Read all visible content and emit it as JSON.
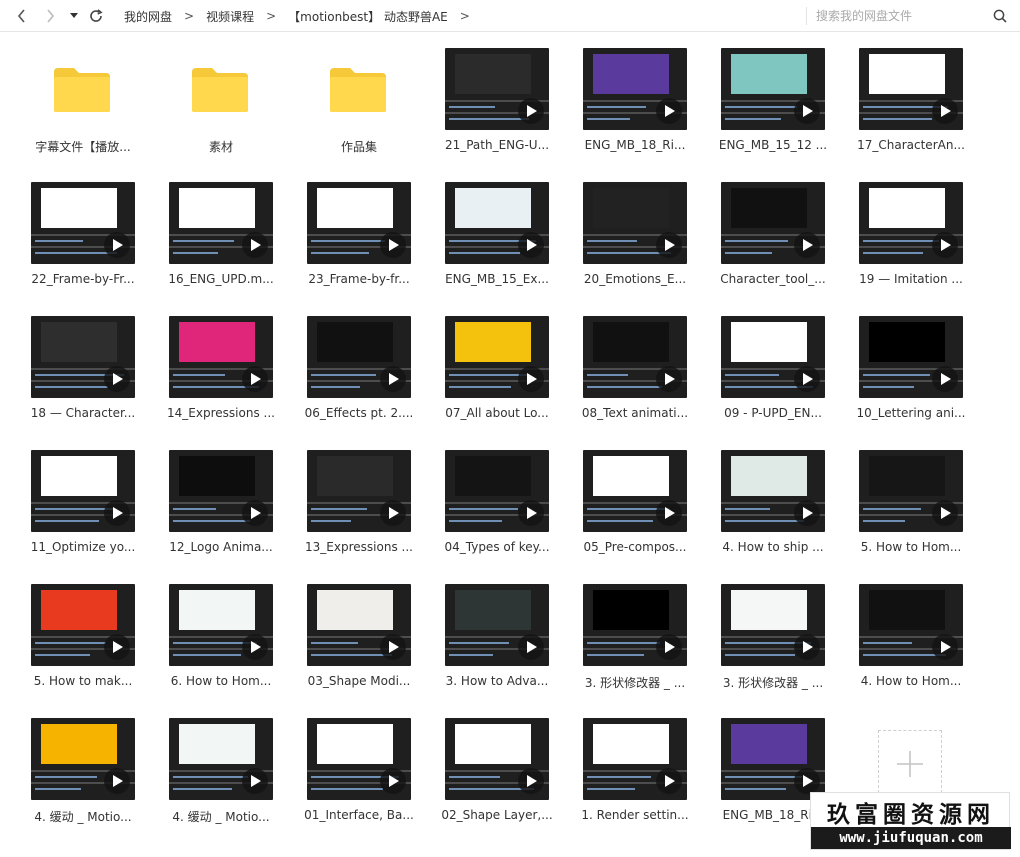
{
  "toolbar": {
    "breadcrumb": [
      "我的网盘",
      "视频课程",
      "【motionbest】 动态野兽AE"
    ],
    "search_placeholder": "搜索我的网盘文件"
  },
  "items": [
    {
      "type": "folder",
      "label": "字幕文件【播放..."
    },
    {
      "type": "folder",
      "label": "素材"
    },
    {
      "type": "folder",
      "label": "作品集"
    },
    {
      "type": "video",
      "label": "21_Path_ENG-U...",
      "panel": "#2b2b2b"
    },
    {
      "type": "video",
      "label": "ENG_MB_18_Ri...",
      "panel": "#5b3a9e"
    },
    {
      "type": "video",
      "label": "ENG_MB_15_12 ...",
      "panel": "#7fc6c0"
    },
    {
      "type": "video",
      "label": "17_CharacterAn...",
      "panel": "#ffffff"
    },
    {
      "type": "video",
      "label": "22_Frame-by-Fr...",
      "panel": "#ffffff"
    },
    {
      "type": "video",
      "label": "16_ENG_UPD.m...",
      "panel": "#ffffff"
    },
    {
      "type": "video",
      "label": "23_Frame-by-fr...",
      "panel": "#ffffff"
    },
    {
      "type": "video",
      "label": "ENG_MB_15_Ex...",
      "panel": "#e8f0f4"
    },
    {
      "type": "video",
      "label": "20_Emotions_E...",
      "panel": "#222222"
    },
    {
      "type": "video",
      "label": "Character_tool_...",
      "panel": "#111111"
    },
    {
      "type": "video",
      "label": "19 — Imitation ...",
      "panel": "#ffffff"
    },
    {
      "type": "video",
      "label": "18 — Character...",
      "panel": "#2e2e2e"
    },
    {
      "type": "video",
      "label": "14_Expressions ...",
      "panel": "#e0267a"
    },
    {
      "type": "video",
      "label": "06_Effects pt. 2....",
      "panel": "#111111"
    },
    {
      "type": "video",
      "label": "07_All about Lo...",
      "panel": "#f4c20d"
    },
    {
      "type": "video",
      "label": "08_Text animati...",
      "panel": "#111111"
    },
    {
      "type": "video",
      "label": "09 - P-UPD_EN...",
      "panel": "#ffffff"
    },
    {
      "type": "video",
      "label": "10_Lettering ani...",
      "panel": "#000000"
    },
    {
      "type": "video",
      "label": "11_Optimize yo...",
      "panel": "#ffffff"
    },
    {
      "type": "video",
      "label": "12_Logo Anima...",
      "panel": "#0d0d0d"
    },
    {
      "type": "video",
      "label": "13_Expressions ...",
      "panel": "#2a2a2a"
    },
    {
      "type": "video",
      "label": "04_Types of key...",
      "panel": "#141414"
    },
    {
      "type": "video",
      "label": "05_Pre-compos...",
      "panel": "#ffffff"
    },
    {
      "type": "video",
      "label": "4. How to ship ...",
      "panel": "#dfe9e6"
    },
    {
      "type": "video",
      "label": "5. How to Hom...",
      "panel": "#161616"
    },
    {
      "type": "video",
      "label": "5. How to mak...",
      "panel": "#e83a1f"
    },
    {
      "type": "video",
      "label": "6. How to Hom...",
      "panel": "#f2f6f4"
    },
    {
      "type": "video",
      "label": "03_Shape Modi...",
      "panel": "#efeeea"
    },
    {
      "type": "video",
      "label": "3. How to Adva...",
      "panel": "#2d3535"
    },
    {
      "type": "video",
      "label": "3. 形状修改器 _ ...",
      "panel": "#000000"
    },
    {
      "type": "video",
      "label": "3. 形状修改器 _ ...",
      "panel": "#f4f7f6"
    },
    {
      "type": "video",
      "label": "4. How to Hom...",
      "panel": "#111111"
    },
    {
      "type": "video",
      "label": "4. 缓动 _ Motio...",
      "panel": "#f6b400"
    },
    {
      "type": "video",
      "label": "4. 缓动 _ Motio...",
      "panel": "#f2f6f4"
    },
    {
      "type": "video",
      "label": "01_Interface, Ba...",
      "panel": "#ffffff"
    },
    {
      "type": "video",
      "label": "02_Shape Layer,...",
      "panel": "#ffffff"
    },
    {
      "type": "video",
      "label": "1. Render settin...",
      "panel": "#ffffff"
    },
    {
      "type": "video",
      "label": "ENG_MB_18_Ri...",
      "panel": "#5b3a9e"
    }
  ],
  "colors": {
    "folder": "#ffd84d",
    "folder_tab": "#f6c93a",
    "thumb_bg": "#1f1f1f"
  },
  "watermark": {
    "title": "玖富圈资源网",
    "url": "www.jiufuquan.com"
  }
}
